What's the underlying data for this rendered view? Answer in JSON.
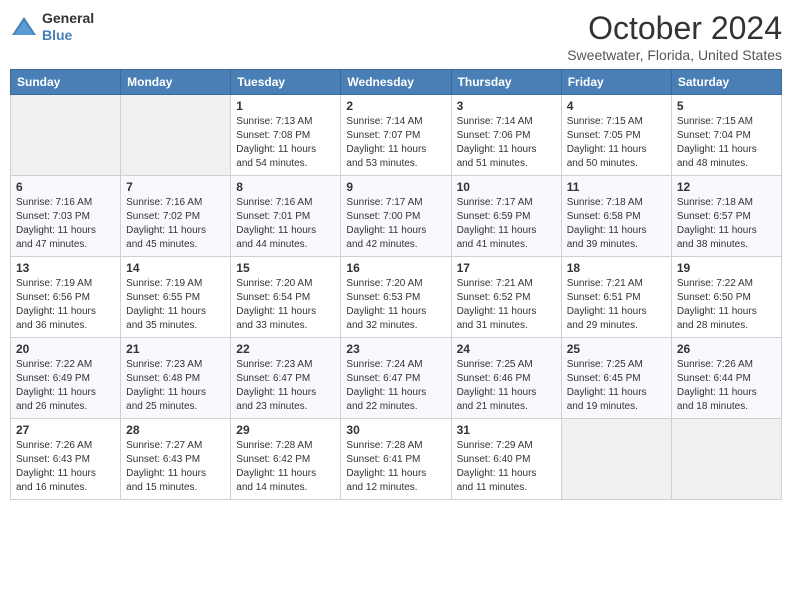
{
  "logo": {
    "general": "General",
    "blue": "Blue"
  },
  "header": {
    "month": "October 2024",
    "location": "Sweetwater, Florida, United States"
  },
  "weekdays": [
    "Sunday",
    "Monday",
    "Tuesday",
    "Wednesday",
    "Thursday",
    "Friday",
    "Saturday"
  ],
  "weeks": [
    [
      {
        "day": "",
        "info": ""
      },
      {
        "day": "",
        "info": ""
      },
      {
        "day": "1",
        "info": "Sunrise: 7:13 AM\nSunset: 7:08 PM\nDaylight: 11 hours and 54 minutes."
      },
      {
        "day": "2",
        "info": "Sunrise: 7:14 AM\nSunset: 7:07 PM\nDaylight: 11 hours and 53 minutes."
      },
      {
        "day": "3",
        "info": "Sunrise: 7:14 AM\nSunset: 7:06 PM\nDaylight: 11 hours and 51 minutes."
      },
      {
        "day": "4",
        "info": "Sunrise: 7:15 AM\nSunset: 7:05 PM\nDaylight: 11 hours and 50 minutes."
      },
      {
        "day": "5",
        "info": "Sunrise: 7:15 AM\nSunset: 7:04 PM\nDaylight: 11 hours and 48 minutes."
      }
    ],
    [
      {
        "day": "6",
        "info": "Sunrise: 7:16 AM\nSunset: 7:03 PM\nDaylight: 11 hours and 47 minutes."
      },
      {
        "day": "7",
        "info": "Sunrise: 7:16 AM\nSunset: 7:02 PM\nDaylight: 11 hours and 45 minutes."
      },
      {
        "day": "8",
        "info": "Sunrise: 7:16 AM\nSunset: 7:01 PM\nDaylight: 11 hours and 44 minutes."
      },
      {
        "day": "9",
        "info": "Sunrise: 7:17 AM\nSunset: 7:00 PM\nDaylight: 11 hours and 42 minutes."
      },
      {
        "day": "10",
        "info": "Sunrise: 7:17 AM\nSunset: 6:59 PM\nDaylight: 11 hours and 41 minutes."
      },
      {
        "day": "11",
        "info": "Sunrise: 7:18 AM\nSunset: 6:58 PM\nDaylight: 11 hours and 39 minutes."
      },
      {
        "day": "12",
        "info": "Sunrise: 7:18 AM\nSunset: 6:57 PM\nDaylight: 11 hours and 38 minutes."
      }
    ],
    [
      {
        "day": "13",
        "info": "Sunrise: 7:19 AM\nSunset: 6:56 PM\nDaylight: 11 hours and 36 minutes."
      },
      {
        "day": "14",
        "info": "Sunrise: 7:19 AM\nSunset: 6:55 PM\nDaylight: 11 hours and 35 minutes."
      },
      {
        "day": "15",
        "info": "Sunrise: 7:20 AM\nSunset: 6:54 PM\nDaylight: 11 hours and 33 minutes."
      },
      {
        "day": "16",
        "info": "Sunrise: 7:20 AM\nSunset: 6:53 PM\nDaylight: 11 hours and 32 minutes."
      },
      {
        "day": "17",
        "info": "Sunrise: 7:21 AM\nSunset: 6:52 PM\nDaylight: 11 hours and 31 minutes."
      },
      {
        "day": "18",
        "info": "Sunrise: 7:21 AM\nSunset: 6:51 PM\nDaylight: 11 hours and 29 minutes."
      },
      {
        "day": "19",
        "info": "Sunrise: 7:22 AM\nSunset: 6:50 PM\nDaylight: 11 hours and 28 minutes."
      }
    ],
    [
      {
        "day": "20",
        "info": "Sunrise: 7:22 AM\nSunset: 6:49 PM\nDaylight: 11 hours and 26 minutes."
      },
      {
        "day": "21",
        "info": "Sunrise: 7:23 AM\nSunset: 6:48 PM\nDaylight: 11 hours and 25 minutes."
      },
      {
        "day": "22",
        "info": "Sunrise: 7:23 AM\nSunset: 6:47 PM\nDaylight: 11 hours and 23 minutes."
      },
      {
        "day": "23",
        "info": "Sunrise: 7:24 AM\nSunset: 6:47 PM\nDaylight: 11 hours and 22 minutes."
      },
      {
        "day": "24",
        "info": "Sunrise: 7:25 AM\nSunset: 6:46 PM\nDaylight: 11 hours and 21 minutes."
      },
      {
        "day": "25",
        "info": "Sunrise: 7:25 AM\nSunset: 6:45 PM\nDaylight: 11 hours and 19 minutes."
      },
      {
        "day": "26",
        "info": "Sunrise: 7:26 AM\nSunset: 6:44 PM\nDaylight: 11 hours and 18 minutes."
      }
    ],
    [
      {
        "day": "27",
        "info": "Sunrise: 7:26 AM\nSunset: 6:43 PM\nDaylight: 11 hours and 16 minutes."
      },
      {
        "day": "28",
        "info": "Sunrise: 7:27 AM\nSunset: 6:43 PM\nDaylight: 11 hours and 15 minutes."
      },
      {
        "day": "29",
        "info": "Sunrise: 7:28 AM\nSunset: 6:42 PM\nDaylight: 11 hours and 14 minutes."
      },
      {
        "day": "30",
        "info": "Sunrise: 7:28 AM\nSunset: 6:41 PM\nDaylight: 11 hours and 12 minutes."
      },
      {
        "day": "31",
        "info": "Sunrise: 7:29 AM\nSunset: 6:40 PM\nDaylight: 11 hours and 11 minutes."
      },
      {
        "day": "",
        "info": ""
      },
      {
        "day": "",
        "info": ""
      }
    ]
  ]
}
